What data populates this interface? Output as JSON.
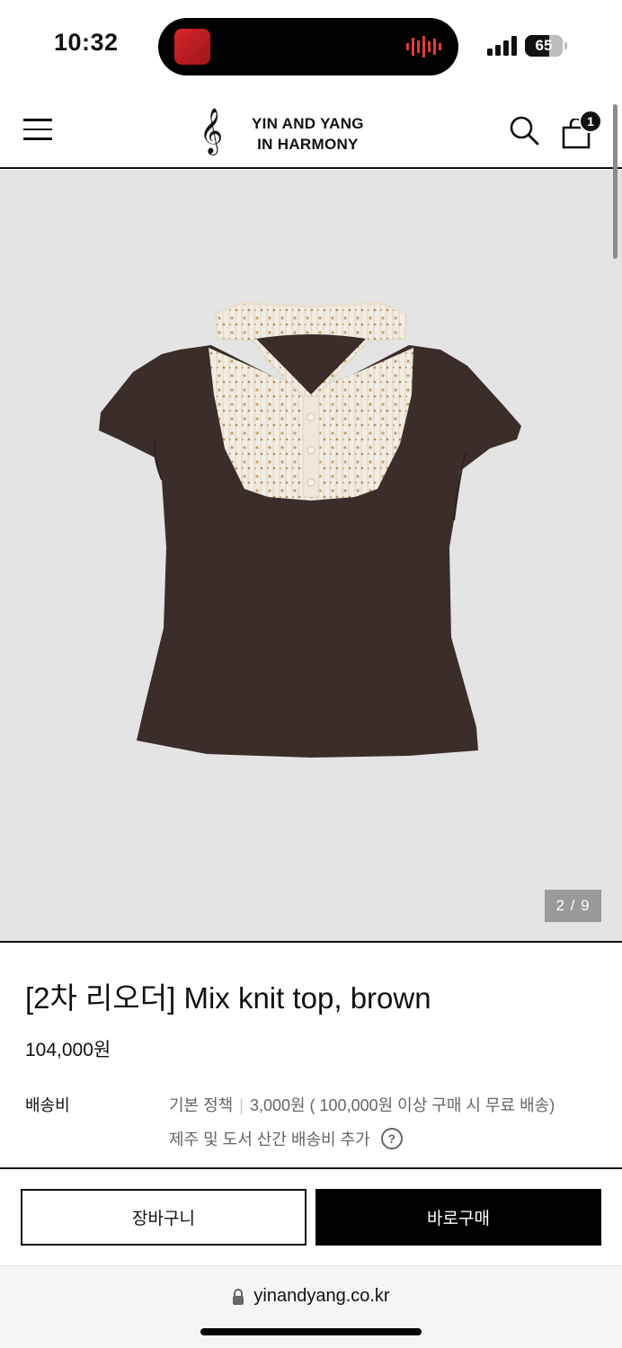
{
  "status_bar": {
    "time": "10:32",
    "battery_percent": 65,
    "battery_label": "65"
  },
  "header": {
    "logo_line1": "YIN AND YANG",
    "logo_line2": "IN HARMONY",
    "logo_symbol": "𝄞",
    "cart_count": "1",
    "icons": [
      "menu-icon",
      "search-icon",
      "shopping-bag-icon"
    ]
  },
  "product": {
    "image_counter": "2 / 9",
    "title": "[2차 리오더] Mix knit top, brown",
    "price": "104,000원",
    "shipping": {
      "label": "배송비",
      "policy": "기본 정책",
      "fee_detail": "3,000원 ( 100,000원 이상 구매 시 무료 배송)",
      "extra_note": "제주 및 도서 산간 배송비 추가",
      "help_symbol": "?"
    }
  },
  "actions": {
    "add_to_cart": "장바구니",
    "buy_now": "바로구매"
  },
  "browser": {
    "url": "yinandyang.co.kr"
  },
  "colors": {
    "image_background": "#e4e4e4",
    "shirt_brown": "#3a2d2a",
    "collar_cream": "#f3ece0",
    "buy_button": "#000000"
  }
}
